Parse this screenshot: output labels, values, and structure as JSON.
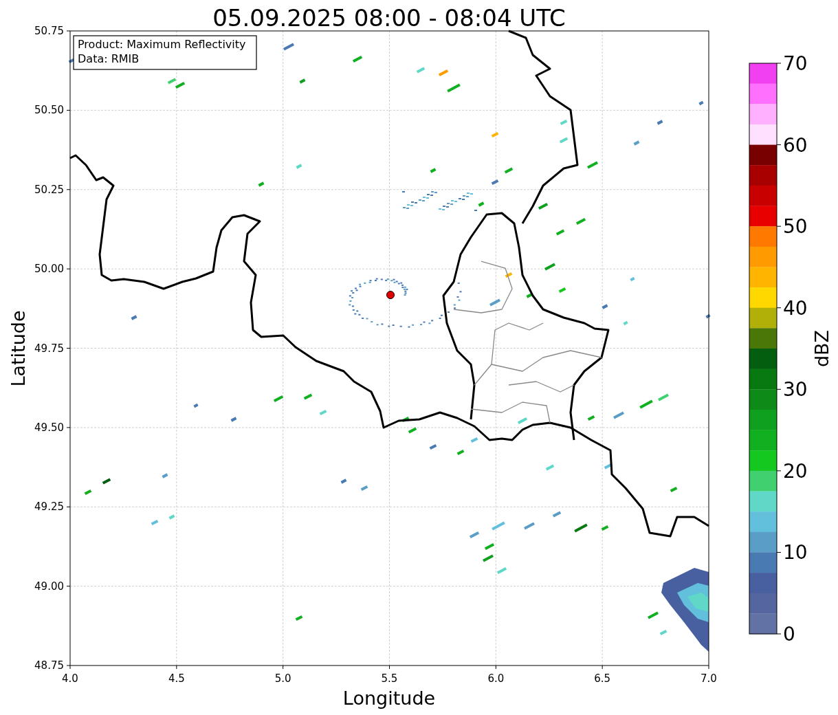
{
  "title": "05.09.2025 08:00 - 08:04 UTC",
  "legend": [
    "Product: Maximum Reflectivity",
    "Data: RMIB"
  ],
  "x_axis": {
    "label": "Longitude",
    "ticks": [
      "4.0",
      "4.5",
      "5.0",
      "5.5",
      "6.0",
      "6.5",
      "7.0"
    ]
  },
  "y_axis": {
    "label": "Latitude",
    "ticks": [
      "50.75",
      "50.50",
      "50.25",
      "50.00",
      "49.75",
      "49.50",
      "49.25",
      "49.00",
      "48.75"
    ]
  },
  "colorbar": {
    "label": "dBZ",
    "ticks": [
      "70",
      "60",
      "50",
      "40",
      "30",
      "20",
      "10",
      "0"
    ],
    "segments": [
      {
        "color": "#f040f0"
      },
      {
        "color": "#ff70ff"
      },
      {
        "color": "#ffb0ff"
      },
      {
        "color": "#ffe0ff"
      },
      {
        "color": "#780000"
      },
      {
        "color": "#a80000"
      },
      {
        "color": "#c80000"
      },
      {
        "color": "#e80000"
      },
      {
        "color": "#ff7800"
      },
      {
        "color": "#ff9a00"
      },
      {
        "color": "#ffb400"
      },
      {
        "color": "#ffd800"
      },
      {
        "color": "#b0b008"
      },
      {
        "color": "#4a7808"
      },
      {
        "color": "#045e10"
      },
      {
        "color": "#087810"
      },
      {
        "color": "#0e8a18"
      },
      {
        "color": "#10a020"
      },
      {
        "color": "#10b020"
      },
      {
        "color": "#14c820"
      },
      {
        "color": "#40d070"
      },
      {
        "color": "#60d8c8"
      },
      {
        "color": "#62c0dc"
      },
      {
        "color": "#5a9ec8"
      },
      {
        "color": "#4a7ab2"
      },
      {
        "color": "#4860a0"
      },
      {
        "color": "#5565a0"
      },
      {
        "color": "#6272a5"
      }
    ]
  }
}
